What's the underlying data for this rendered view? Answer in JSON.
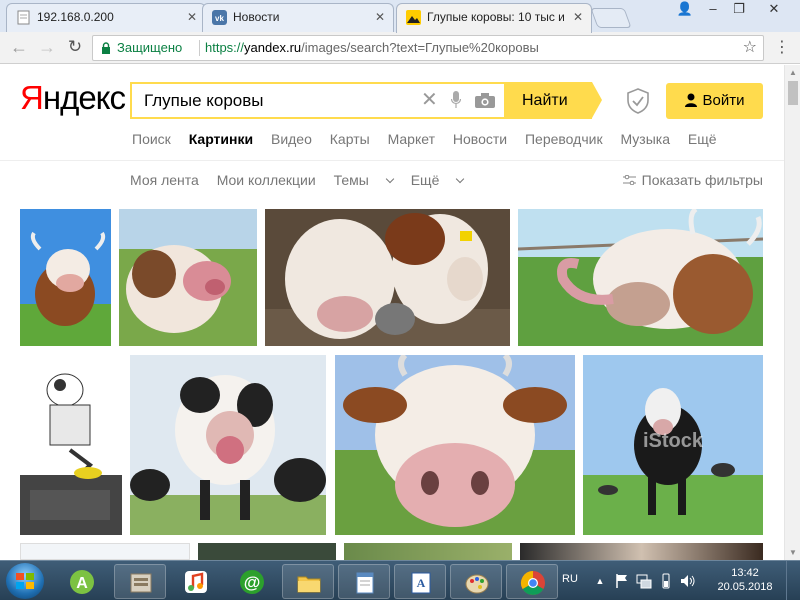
{
  "browser": {
    "tabs": [
      {
        "title": "192.168.0.200",
        "favicon": "page-icon",
        "active": false
      },
      {
        "title": "Новости",
        "favicon": "vk-icon",
        "active": false
      },
      {
        "title": "Глупые коровы: 10 тыс и",
        "favicon": "yandex-images-icon",
        "active": true
      }
    ],
    "secure_label": "Защищено",
    "url_protocol": "https://",
    "url_host": "yandex.ru",
    "url_rest": "/images/search?text=Глупые%20коровы"
  },
  "header": {
    "logo_first": "Я",
    "logo_rest": "ндекс",
    "search_value": "Глупые коровы",
    "search_button": "Найти",
    "login_button": "Войти"
  },
  "services": {
    "items": [
      "Поиск",
      "Картинки",
      "Видео",
      "Карты",
      "Маркет",
      "Новости",
      "Переводчик",
      "Музыка",
      "Ещё"
    ],
    "active_index": 1
  },
  "subnav": {
    "items": [
      "Моя лента",
      "Мои коллекции",
      "Темы",
      "Ещё"
    ],
    "filters_label": "Показать фильтры"
  },
  "results": [
    {
      "subject": "cow facing camera, blue sky",
      "sky": "#3f8fe0",
      "ground": "#5fa83a",
      "fur": "#8b4a22"
    },
    {
      "subject": "cow licking lens, tongue out",
      "sky": "#b8d4e8",
      "ground": "#7aa84a",
      "fur": "#7a4a2a"
    },
    {
      "subject": "two cows with kitten",
      "sky": "#5a4a3a",
      "ground": "#6b5a48",
      "fur": "#f0e8e0"
    },
    {
      "subject": "cow with long tongue near fence",
      "sky": "#bfe0f0",
      "ground": "#5fa040",
      "fur": "#9a5a30"
    },
    {
      "subject": "cow cartoon skateboarding collage",
      "sky": "#ffffff",
      "ground": "#444444",
      "fur": "#ffffff"
    },
    {
      "subject": "black and white cow licking nose",
      "sky": "#dfe8f0",
      "ground": "#8ab060",
      "fur": "#222222"
    },
    {
      "subject": "brown and white cow close-up nose",
      "sky": "#9fc0e8",
      "ground": "#6aa040",
      "fur": "#8b4a22"
    },
    {
      "subject": "black cow standing on meadow, watermark",
      "sky": "#9ec8ee",
      "ground": "#6bb04a",
      "fur": "#1a1a1a",
      "watermark": "iStock"
    }
  ],
  "taskbar": {
    "apps": [
      "windows-explorer-icon",
      "android-icon",
      "media-player-icon",
      "mail-ru-agent-icon",
      "folder-icon",
      "notepad-icon",
      "wordpad-icon",
      "paint-icon",
      "chrome-icon"
    ],
    "language": "RU",
    "time": "13:42",
    "date": "20.05.2018"
  },
  "colors": {
    "accent_yellow": "#ffdb4d",
    "logo_red": "#ff0000",
    "secure_green": "#0b8043"
  }
}
